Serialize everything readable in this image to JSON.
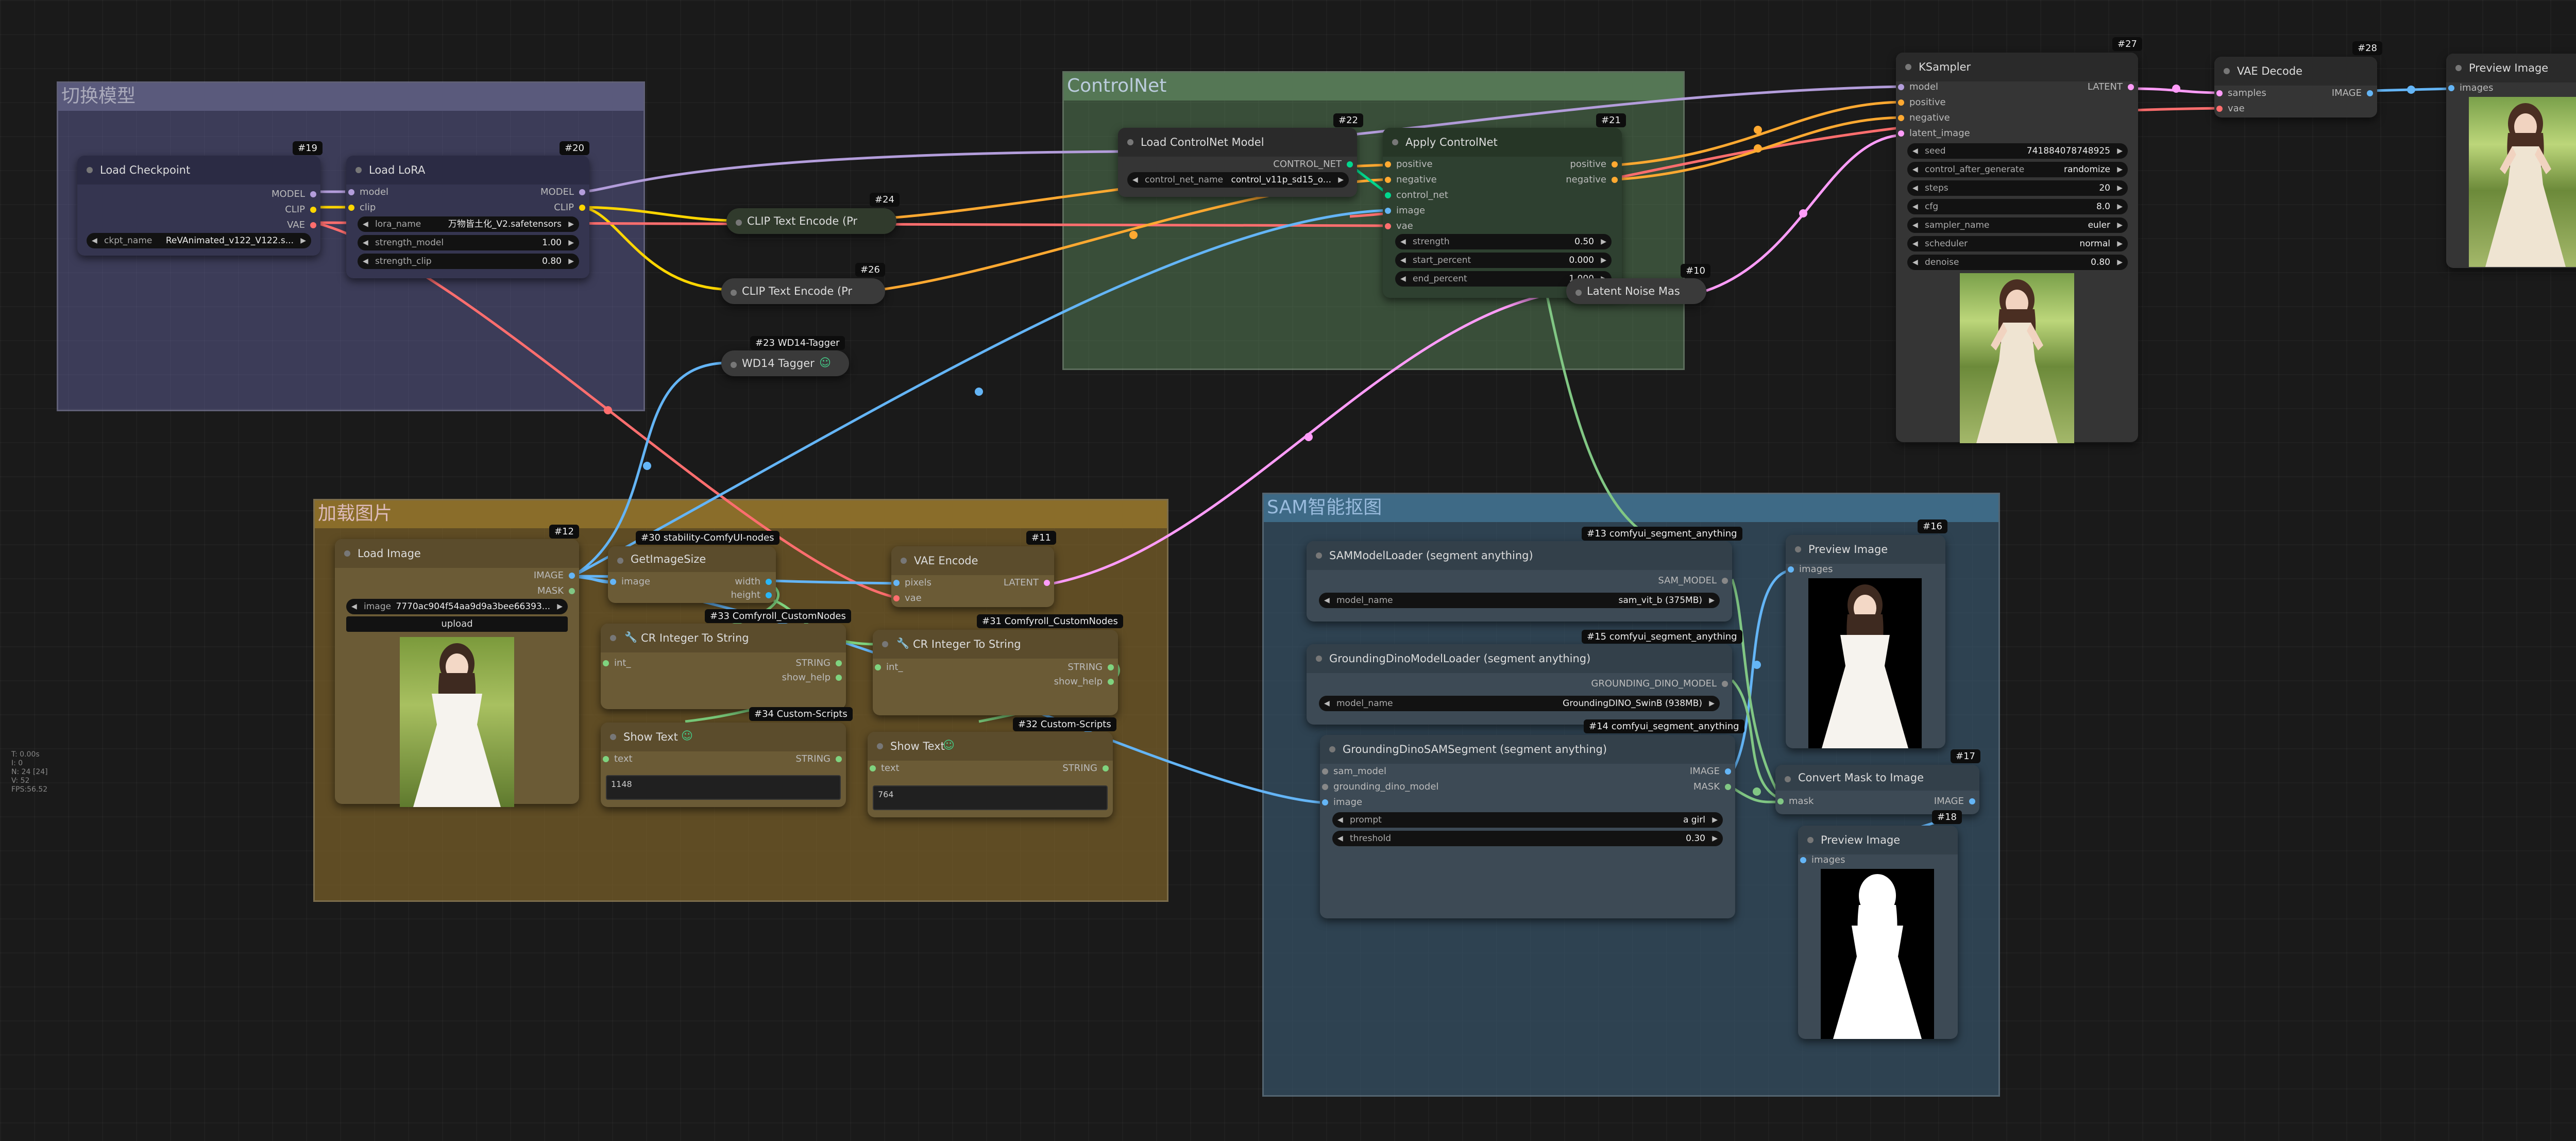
{
  "colors": {
    "model": "#b39ddb",
    "clip": "#ffd600",
    "vae": "#ff6e6e",
    "conditioning": "#ffa931",
    "control_net": "#00d78d",
    "image": "#64b5f6",
    "latent": "#ff9cf9",
    "mask": "#81c784",
    "string": "#7fd37f",
    "int": "#29b6f6"
  },
  "stats": {
    "line1": "T: 0.00s",
    "line2": "I: 0",
    "line3": "N: 24 [24]",
    "line4": "V: 52",
    "line5": "FPS:56.52"
  },
  "groups": {
    "switch_model": "切换模型",
    "controlnet": "ControlNet",
    "load_image": "加载图片",
    "sam": "SAM智能抠图"
  },
  "nodes": {
    "n19": {
      "id": "#19",
      "title": "Load Checkpoint",
      "out_model": "MODEL",
      "out_clip": "CLIP",
      "out_vae": "VAE",
      "ckpt_label": "ckpt_name",
      "ckpt_value": "ReVAnimated_v122_V122.s..."
    },
    "n20": {
      "id": "#20",
      "title": "Load LoRA",
      "in_model": "model",
      "in_clip": "clip",
      "out_model": "MODEL",
      "out_clip": "CLIP",
      "lora_label": "lora_name",
      "lora_value": "万物皆土化_V2.safetensors",
      "sm_label": "strength_model",
      "sm_value": "1.00",
      "sc_label": "strength_clip",
      "sc_value": "0.80"
    },
    "n24": {
      "id": "#24",
      "title": "CLIP Text Encode (Pr"
    },
    "n26": {
      "id": "#26",
      "title": "CLIP Text Encode (Pr"
    },
    "n23": {
      "id": "#23 WD14-Tagger",
      "title": "WD14 Tagger"
    },
    "n22": {
      "id": "#22",
      "title": "Load ControlNet Model",
      "out": "CONTROL_NET",
      "cn_label": "control_net_name",
      "cn_value": "control_v11p_sd15_o..."
    },
    "n21": {
      "id": "#21",
      "title": "Apply ControlNet",
      "in_positive": "positive",
      "in_negative": "negative",
      "in_control_net": "control_net",
      "in_image": "image",
      "in_vae": "vae",
      "out_positive": "positive",
      "out_negative": "negative",
      "strength_label": "strength",
      "strength_value": "0.50",
      "start_label": "start_percent",
      "start_value": "0.000",
      "end_label": "end_percent",
      "end_value": "1.000"
    },
    "n10": {
      "id": "#10",
      "title": "Latent Noise Mas"
    },
    "n27": {
      "id": "#27",
      "title": "KSampler",
      "in_model": "model",
      "in_positive": "positive",
      "in_negative": "negative",
      "in_latent": "latent_image",
      "out_latent": "LATENT",
      "seed_label": "seed",
      "seed_value": "741884078748925",
      "cag_label": "control_after_generate",
      "cag_value": "randomize",
      "steps_label": "steps",
      "steps_value": "20",
      "cfg_label": "cfg",
      "cfg_value": "8.0",
      "sampler_label": "sampler_name",
      "sampler_value": "euler",
      "scheduler_label": "scheduler",
      "scheduler_value": "normal",
      "denoise_label": "denoise",
      "denoise_value": "0.80"
    },
    "n28": {
      "id": "#28",
      "title": "VAE Decode",
      "in_samples": "samples",
      "in_vae": "vae",
      "out_image": "IMAGE"
    },
    "n29": {
      "id": "#29",
      "title": "Preview Image",
      "in_images": "images"
    },
    "n12": {
      "id": "#12",
      "title": "Load Image",
      "out_image": "IMAGE",
      "out_mask": "MASK",
      "image_label": "image",
      "image_value": "7770ac904f54aa9d9a3bee66393...",
      "upload_label": "upload"
    },
    "n30": {
      "id": "#30 stability-ComfyUI-nodes",
      "title": "GetImageSize",
      "in_image": "image",
      "out_width": "width",
      "out_height": "height"
    },
    "n11": {
      "id": "#11",
      "title": "VAE Encode",
      "in_pixels": "pixels",
      "in_vae": "vae",
      "out_latent": "LATENT"
    },
    "n33": {
      "id": "#33 Comfyroll_CustomNodes",
      "title": "CR Integer To String",
      "in_int": "int_",
      "out_string": "STRING",
      "out_help": "show_help"
    },
    "n31": {
      "id": "#31 Comfyroll_CustomNodes",
      "title": "CR Integer To String",
      "in_int": "int_",
      "out_string": "STRING",
      "out_help": "show_help"
    },
    "n34": {
      "id": "#34 Custom-Scripts",
      "title": "Show Text",
      "in_text": "text",
      "out_string": "STRING",
      "text_value": "1148"
    },
    "n32": {
      "id": "#32 Custom-Scripts",
      "title": "Show Text",
      "in_text": "text",
      "out_string": "STRING",
      "text_value": "764"
    },
    "n13": {
      "id": "#13 comfyui_segment_anything",
      "title": "SAMModelLoader (segment anything)",
      "out": "SAM_MODEL",
      "model_label": "model_name",
      "model_value": "sam_vit_b (375MB)"
    },
    "n15": {
      "id": "#15 comfyui_segment_anything",
      "title": "GroundingDinoModelLoader (segment anything)",
      "out": "GROUNDING_DINO_MODEL",
      "model_label": "model_name",
      "model_value": "GroundingDINO_SwinB (938MB)"
    },
    "n14": {
      "id": "#14 comfyui_segment_anything",
      "title": "GroundingDinoSAMSegment (segment anything)",
      "in_sam": "sam_model",
      "in_dino": "grounding_dino_model",
      "in_image": "image",
      "out_image": "IMAGE",
      "out_mask": "MASK",
      "prompt_label": "prompt",
      "prompt_value": "a girl",
      "threshold_label": "threshold",
      "threshold_value": "0.30"
    },
    "n16": {
      "id": "#16",
      "title": "Preview Image",
      "in_images": "images"
    },
    "n17": {
      "id": "#17",
      "title": "Convert Mask to Image",
      "in_mask": "mask",
      "out_image": "IMAGE"
    },
    "n18": {
      "id": "#18",
      "title": "Preview Image",
      "in_images": "images"
    }
  }
}
